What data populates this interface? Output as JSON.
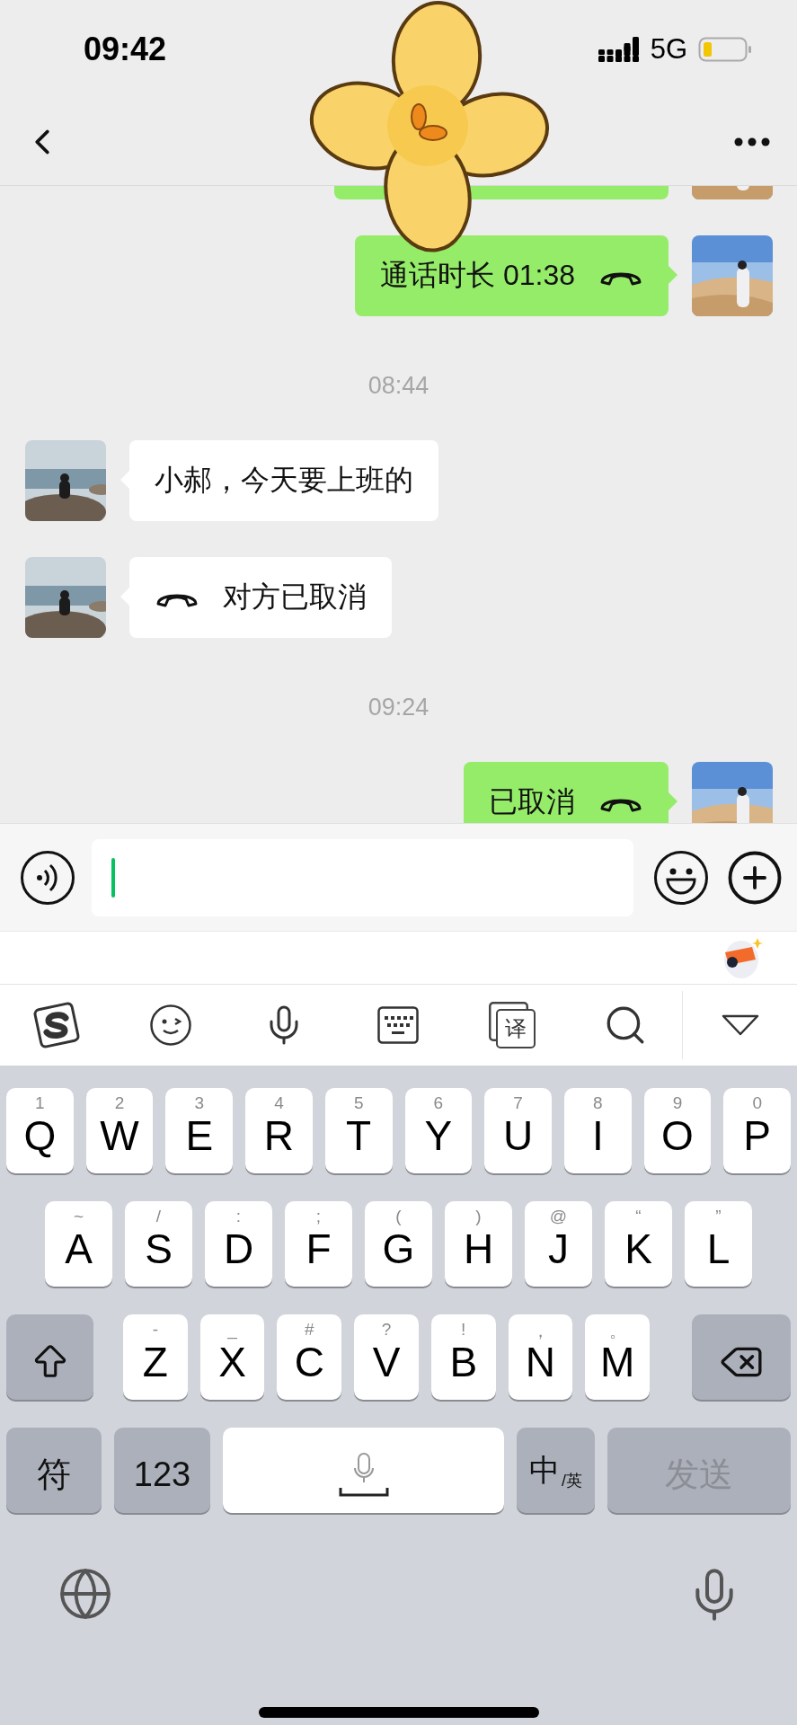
{
  "status_bar": {
    "time": "09:42",
    "network": "5G"
  },
  "messages": [
    {
      "kind": "partial",
      "outgoing": true
    },
    {
      "kind": "call",
      "outgoing": true,
      "text": "通话时长 01:38"
    },
    {
      "kind": "time",
      "text": "08:44"
    },
    {
      "kind": "text",
      "outgoing": false,
      "text": "小郝，今天要上班的"
    },
    {
      "kind": "call",
      "outgoing": false,
      "text": "对方已取消"
    },
    {
      "kind": "time",
      "text": "09:24"
    },
    {
      "kind": "call",
      "outgoing": true,
      "text": "已取消"
    }
  ],
  "toolbar": {
    "translate_glyph": "译"
  },
  "keyboard": {
    "rows": [
      [
        {
          "label": "Q",
          "hint": "1"
        },
        {
          "label": "W",
          "hint": "2"
        },
        {
          "label": "E",
          "hint": "3"
        },
        {
          "label": "R",
          "hint": "4"
        },
        {
          "label": "T",
          "hint": "5"
        },
        {
          "label": "Y",
          "hint": "6"
        },
        {
          "label": "U",
          "hint": "7"
        },
        {
          "label": "I",
          "hint": "8"
        },
        {
          "label": "O",
          "hint": "9"
        },
        {
          "label": "P",
          "hint": "0"
        }
      ],
      [
        {
          "label": "A",
          "hint": "~"
        },
        {
          "label": "S",
          "hint": "/"
        },
        {
          "label": "D",
          "hint": ":"
        },
        {
          "label": "F",
          "hint": ";"
        },
        {
          "label": "G",
          "hint": "("
        },
        {
          "label": "H",
          "hint": ")"
        },
        {
          "label": "J",
          "hint": "@"
        },
        {
          "label": "K",
          "hint": "“"
        },
        {
          "label": "L",
          "hint": "”"
        }
      ],
      [
        {
          "label": "Z",
          "hint": "-"
        },
        {
          "label": "X",
          "hint": "_"
        },
        {
          "label": "C",
          "hint": "#"
        },
        {
          "label": "V",
          "hint": "?"
        },
        {
          "label": "B",
          "hint": "!"
        },
        {
          "label": "N",
          "hint": "，"
        },
        {
          "label": "M",
          "hint": "。"
        }
      ]
    ],
    "symbols_key": "符",
    "numbers_key": "123",
    "lang_key": {
      "main": "中",
      "sub": "/英"
    },
    "send_key": {
      "label": "发送",
      "disabled": true
    }
  }
}
